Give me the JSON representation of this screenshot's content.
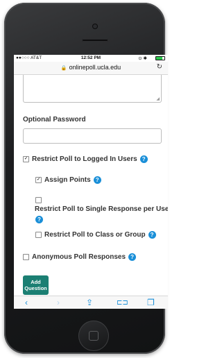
{
  "status": {
    "carrier": "●●○○○ AT&T ",
    "wifi_icon": "wifi-icon",
    "time": "12:52 PM",
    "indicators": "⊙ ✱"
  },
  "browser": {
    "url": "onlinepoll.ucla.edu",
    "lock_glyph": "🔒",
    "reload_glyph": "↻"
  },
  "form": {
    "optional_password_label": "Optional Password",
    "restrict_logged_in": {
      "label": "Restrict Poll to Logged In Users",
      "checked": true
    },
    "assign_points": {
      "label": "Assign Points",
      "checked": true
    },
    "restrict_single_response": {
      "label": "Restrict Poll to Single Response per User",
      "checked": false
    },
    "restrict_class_group": {
      "label": "Restrict Poll to Class or Group",
      "checked": false
    },
    "anonymous_responses": {
      "label": "Anonymous Poll Responses",
      "checked": false
    },
    "help_glyph": "?",
    "check_glyph": "✓",
    "add_question_button": "Add\nQuestion",
    "button_color": "#1b7f73",
    "help_color": "#1a8fd8"
  },
  "toolbar": {
    "back": "‹",
    "forward": "›",
    "share": "⇪",
    "bookmarks": "⊏⊐",
    "tabs": "❐"
  }
}
